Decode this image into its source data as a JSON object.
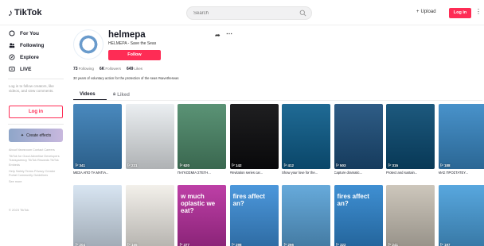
{
  "header": {
    "logo_text": "TikTok",
    "search_placeholder": "Search",
    "upload_label": "Upload",
    "login_label": "Log in"
  },
  "sidebar": {
    "nav": [
      {
        "label": "For You",
        "icon": "home-icon"
      },
      {
        "label": "Following",
        "icon": "following-icon"
      },
      {
        "label": "Explore",
        "icon": "compass-icon"
      },
      {
        "label": "LIVE",
        "icon": "live-icon"
      }
    ],
    "login_prompt": "Log in to follow creators, like videos, and view comments.",
    "login_button": "Log in",
    "effects_label": "Create effects",
    "footer_links": [
      "About  Newsroom  Contact  Careers",
      "TikTok for Good  Advertise  Developers  Transparency  TikTok Rewards  TikTok Embeds",
      "Help  Safety  Terms  Privacy  Creator Portal  Community Guidelines",
      "See more"
    ],
    "copyright": "© 2023 TikTok"
  },
  "profile": {
    "username": "helmepa",
    "nickname": "HELMEPA - Save the Seas",
    "follow_label": "Follow",
    "stats": {
      "following_count": "73",
      "following_label": "Following",
      "followers_count": "6K",
      "followers_label": "Followers",
      "likes_count": "649",
      "likes_label": "Likes"
    },
    "bio": "30 years of voluntary action for the protection of the seas #savetheseas"
  },
  "tabs": {
    "videos": "Videos",
    "liked": "Liked"
  },
  "videos": [
    {
      "views": "341",
      "caption": "ΜΕΣΑ ΑΠΟ ΤΑ ΜΑΤΙΑ...",
      "bg": "#3a7fb8",
      "text": ""
    },
    {
      "views": "231",
      "caption": "",
      "bg": "#e9edf0",
      "text": ""
    },
    {
      "views": "620",
      "caption": "ΠΑΓΚΟΣΜΙΑ ΣΤΕΓΗ...",
      "bg": "#4d8a6a",
      "text": ""
    },
    {
      "views": "142",
      "caption": "#Invitation series car...",
      "bg": "#0c0c0e",
      "text": ""
    },
    {
      "views": "412",
      "caption": "Show your love for the...",
      "bg": "#0d5e8c",
      "text": ""
    },
    {
      "views": "503",
      "caption": "Capture dramatic...",
      "bg": "#1d4f7c",
      "text": ""
    },
    {
      "views": "315",
      "caption": "Protect and sustain...",
      "bg": "#0a4b73",
      "text": ""
    },
    {
      "views": "188",
      "caption": "ΜΑΣ ΠΡΟΣΤΑΤΕΥ...",
      "bg": "#3989c6",
      "text": ""
    },
    {
      "views": "204",
      "caption": "",
      "bg": "#d5e3f1",
      "text": ""
    },
    {
      "views": "155",
      "caption": "",
      "bg": "#f2efe9",
      "text": ""
    },
    {
      "views": "377",
      "caption": "",
      "bg": "#b82f9f",
      "text": "w much oplastic we eat?"
    },
    {
      "views": "298",
      "caption": "",
      "bg": "#3d8fd9",
      "text": "fires affect an?"
    },
    {
      "views": "266",
      "caption": "",
      "bg": "#5aa3d8",
      "text": ""
    },
    {
      "views": "322",
      "caption": "",
      "bg": "#2f86cf",
      "text": "fires affect an?"
    },
    {
      "views": "241",
      "caption": "",
      "bg": "#c9c2b6",
      "text": ""
    },
    {
      "views": "197",
      "caption": "",
      "bg": "#4aa0dc",
      "text": ""
    }
  ]
}
